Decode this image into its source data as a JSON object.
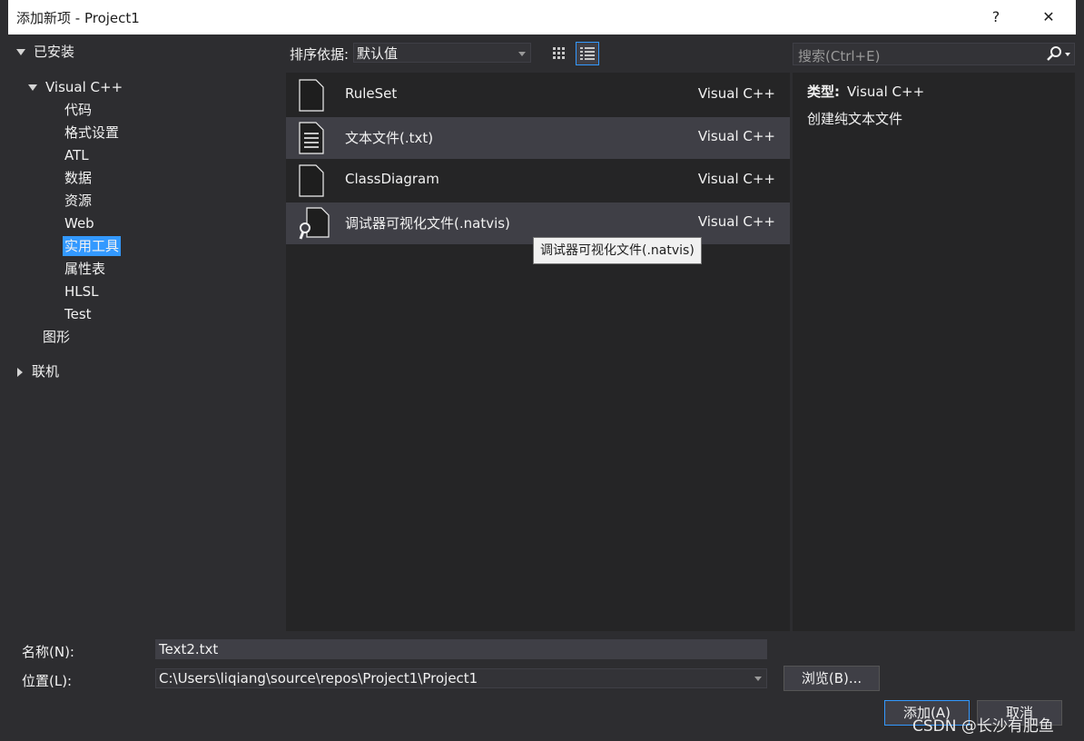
{
  "window": {
    "title": "添加新项 - Project1",
    "help_label": "?",
    "close_label": "✕"
  },
  "tree": {
    "installed_label": "已安装",
    "root_label": "Visual C++",
    "children": [
      "代码",
      "格式设置",
      "ATL",
      "数据",
      "资源",
      "Web",
      "实用工具",
      "属性表",
      "HLSL",
      "Test"
    ],
    "selected_child": "实用工具",
    "graphics_label": "图形",
    "online_label": "联机"
  },
  "sort": {
    "label": "排序依据:",
    "value": "默认值"
  },
  "search": {
    "placeholder": "搜索(Ctrl+E)"
  },
  "templates": [
    {
      "name": "RuleSet",
      "lang": "Visual C++",
      "icon": "document-icon"
    },
    {
      "name": "文本文件(.txt)",
      "lang": "Visual C++",
      "icon": "text-file-icon",
      "selected": true
    },
    {
      "name": "ClassDiagram",
      "lang": "Visual C++",
      "icon": "document-icon"
    },
    {
      "name": "调试器可视化文件(.natvis)",
      "lang": "Visual C++",
      "icon": "natvis-file-icon",
      "hovered": true
    }
  ],
  "tooltip": "调试器可视化文件(.natvis)",
  "details": {
    "type_label": "类型:",
    "type_value": "Visual C++",
    "description": "创建纯文本文件"
  },
  "form": {
    "name_label": "名称(N):",
    "name_value": "Text2.txt",
    "location_label": "位置(L):",
    "location_value": "C:\\Users\\liqiang\\source\\repos\\Project1\\Project1",
    "browse_label": "浏览(B)...",
    "add_label": "添加(A)",
    "cancel_label": "取消"
  },
  "watermark": "CSDN @长沙有肥鱼",
  "colors": {
    "selection": "#3399ff",
    "panel": "#252526",
    "dialog": "#2d2d30"
  }
}
